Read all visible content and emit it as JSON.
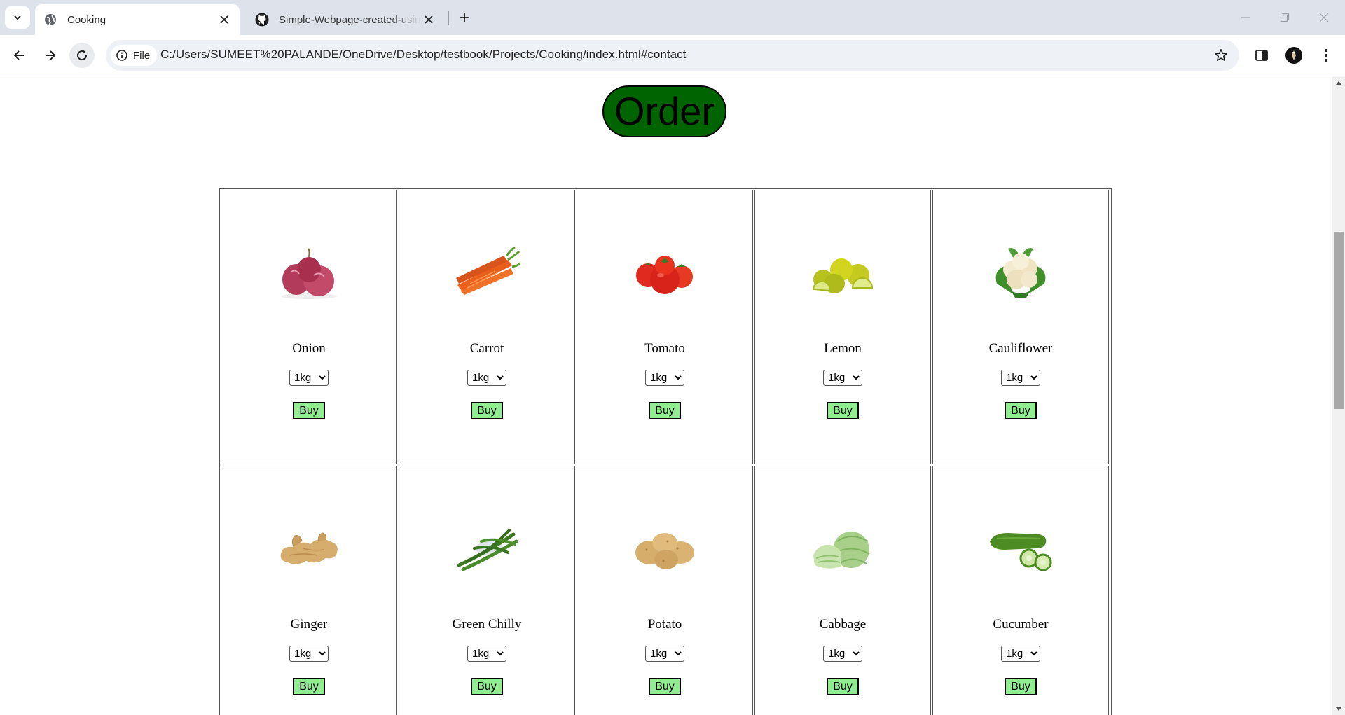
{
  "browser": {
    "tabs": [
      {
        "title": "Cooking",
        "active": true,
        "favicon": "globe-icon"
      },
      {
        "title": "Simple-Webpage-created-using-HTML",
        "active": false,
        "favicon": "github-icon"
      }
    ],
    "omnibox": {
      "chip_label": "File",
      "url": "C:/Users/SUMEET%20PALANDE/OneDrive/Desktop/testbook/Projects/Cooking/index.html#contact"
    }
  },
  "page": {
    "order_label": "Order",
    "order_color": "#006400",
    "buy_color": "#90ee90",
    "products": [
      {
        "name": "Onion",
        "qty": "1kg",
        "buy_label": "Buy",
        "icon": "onion-image"
      },
      {
        "name": "Carrot",
        "qty": "1kg",
        "buy_label": "Buy",
        "icon": "carrot-image"
      },
      {
        "name": "Tomato",
        "qty": "1kg",
        "buy_label": "Buy",
        "icon": "tomato-image"
      },
      {
        "name": "Lemon",
        "qty": "1kg",
        "buy_label": "Buy",
        "icon": "lemon-image"
      },
      {
        "name": "Cauliflower",
        "qty": "1kg",
        "buy_label": "Buy",
        "icon": "cauliflower-image"
      },
      {
        "name": "Ginger",
        "qty": "1kg",
        "buy_label": "Buy",
        "icon": "ginger-image"
      },
      {
        "name": "Green Chilly",
        "qty": "1kg",
        "buy_label": "Buy",
        "icon": "green-chilly-image"
      },
      {
        "name": "Potato",
        "qty": "1kg",
        "buy_label": "Buy",
        "icon": "potato-image"
      },
      {
        "name": "Cabbage",
        "qty": "1kg",
        "buy_label": "Buy",
        "icon": "cabbage-image"
      },
      {
        "name": "Cucumber",
        "qty": "1kg",
        "buy_label": "Buy",
        "icon": "cucumber-image"
      }
    ]
  }
}
